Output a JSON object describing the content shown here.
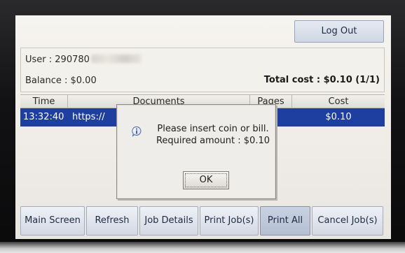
{
  "header": {
    "logout_label": "Log Out"
  },
  "account": {
    "user_label": "User : 290780",
    "balance_label": "Balance : $0.00",
    "total_cost_label": "Total cost : $0.10  (1/1)"
  },
  "table": {
    "columns": [
      "Time",
      "Documents",
      "Pages",
      "Cost"
    ],
    "rows": [
      {
        "time": "13:32:40",
        "document": "https://",
        "pages": "",
        "cost": "$0.10"
      }
    ]
  },
  "dialog": {
    "line1": "Please insert coin or bill.",
    "line2": "Required amount : $0.10",
    "ok_label": "OK",
    "icon": "info-icon"
  },
  "buttons": {
    "main_screen": "Main Screen",
    "refresh": "Refresh",
    "job_details": "Job Details",
    "print_jobs": "Print Job(s)",
    "print_all": "Print All",
    "cancel_jobs": "Cancel Job(s)"
  },
  "colors": {
    "selected_row": "#1f3fa0",
    "button_text": "#1e2a44",
    "screen_bg": "#f3f1ec"
  }
}
